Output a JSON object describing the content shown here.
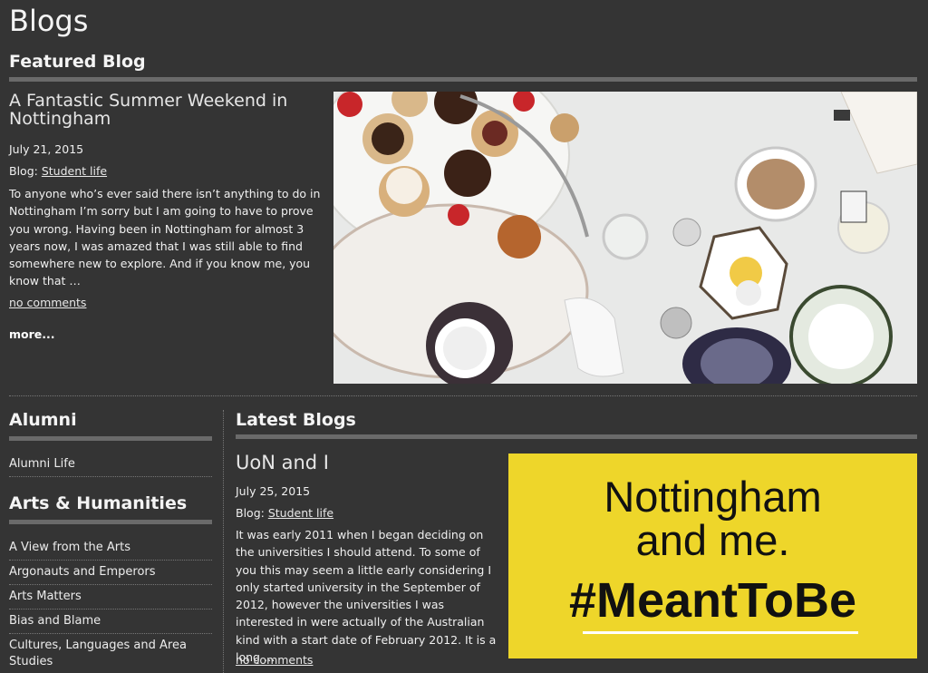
{
  "page": {
    "title": "Blogs"
  },
  "featured": {
    "heading": "Featured Blog",
    "post": {
      "title": "A Fantastic Summer Weekend in Nottingham",
      "date": "July 21, 2015",
      "blog_prefix": "Blog:",
      "blog_name": "Student life",
      "excerpt": "To anyone who’s ever said there isn’t anything to do in Nottingham I’m sorry but I am going to have to prove you wrong. Having been in Nottingham for almost 3 years now, I was amazed that I was still able to find somewhere new to explore. And if you know me, you know that …",
      "comments": "no comments",
      "more": "more..."
    }
  },
  "sidebar": {
    "categories": [
      {
        "heading": "Alumni",
        "items": [
          "Alumni Life"
        ]
      },
      {
        "heading": "Arts & Humanities",
        "items": [
          "A View from the Arts",
          "Argonauts and Emperors",
          "Arts Matters",
          "Bias and Blame",
          "Cultures, Languages and Area Studies"
        ]
      }
    ]
  },
  "latest": {
    "heading": "Latest Blogs",
    "post": {
      "title": "UoN and I",
      "date": "July 25, 2015",
      "blog_prefix": "Blog:",
      "blog_name": "Student life",
      "excerpt": "It was early 2011 when I began deciding on the universities I should attend. To some of you this may seem a little early considering I only started university in the September of 2012, however the universities I was interested in were actually of the Australian kind with a start date of February 2012. It is a long …",
      "comments": "no comments",
      "image": {
        "line1": "Nottingham",
        "line2": "and me.",
        "line3": "#MeantToBe",
        "background": "#eed62a"
      }
    }
  },
  "colors": {
    "background": "#343434",
    "rule": "#6a6a6a",
    "text": "#f2f2f2"
  }
}
